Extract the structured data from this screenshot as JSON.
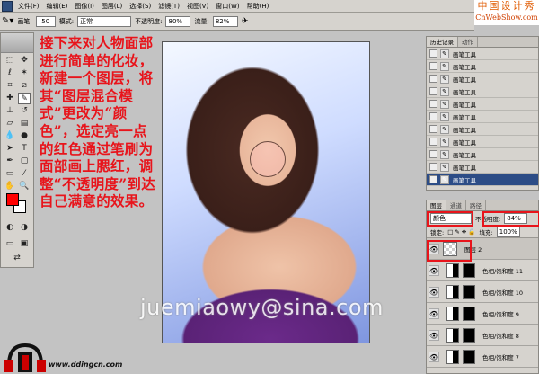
{
  "menubar": {
    "items": [
      "文件(F)",
      "编辑(E)",
      "图像(I)",
      "图层(L)",
      "选择(S)",
      "滤镜(T)",
      "视图(V)",
      "窗口(W)",
      "帮助(H)"
    ]
  },
  "watermark": {
    "line1": "中国设计秀",
    "line2": "CnWebShow.com"
  },
  "options": {
    "brush_label": "画笔:",
    "brush_size": "50",
    "mode_label": "模式:",
    "mode_value": "正常",
    "opacity_label": "不透明度:",
    "opacity_value": "80%",
    "flow_label": "流量:",
    "flow_value": "82%"
  },
  "tutorial_text": "接下来对人物面部进行简单的化妆，新建一个图层，将其“图层混合模式”更改为“颜色”，选定亮一点的红色通过笔刷为面部画上腮红，调整“不透明度”到达自己满意的效果。",
  "email": "juemiaowy@sina.com",
  "bottom_logo": {
    "url": "www.ddingcn.com"
  },
  "history": {
    "tabs": [
      "历史记录",
      "动作"
    ],
    "rows": [
      {
        "label": "画笔工具"
      },
      {
        "label": "画笔工具"
      },
      {
        "label": "画笔工具"
      },
      {
        "label": "画笔工具"
      },
      {
        "label": "画笔工具"
      },
      {
        "label": "画笔工具"
      },
      {
        "label": "画笔工具"
      },
      {
        "label": "画笔工具"
      },
      {
        "label": "画笔工具"
      },
      {
        "label": "画笔工具"
      },
      {
        "label": "画笔工具"
      }
    ]
  },
  "layers": {
    "tabs": [
      "图层",
      "通道",
      "路径"
    ],
    "blend_mode": "颜色",
    "opacity_label": "不透明度:",
    "opacity_value": "84%",
    "lock_label": "锁定:",
    "fill_label": "填充:",
    "fill_value": "100%",
    "items": [
      {
        "name": "图层 2"
      },
      {
        "name": "色相/饱和度 11"
      },
      {
        "name": "色相/饱和度 10"
      },
      {
        "name": "色相/饱和度 9"
      },
      {
        "name": "色相/饱和度 8"
      },
      {
        "name": "色相/饱和度 7"
      }
    ]
  },
  "colors": {
    "foreground": "#ff0000",
    "background": "#ffffff",
    "highlight": "#e8141b"
  }
}
